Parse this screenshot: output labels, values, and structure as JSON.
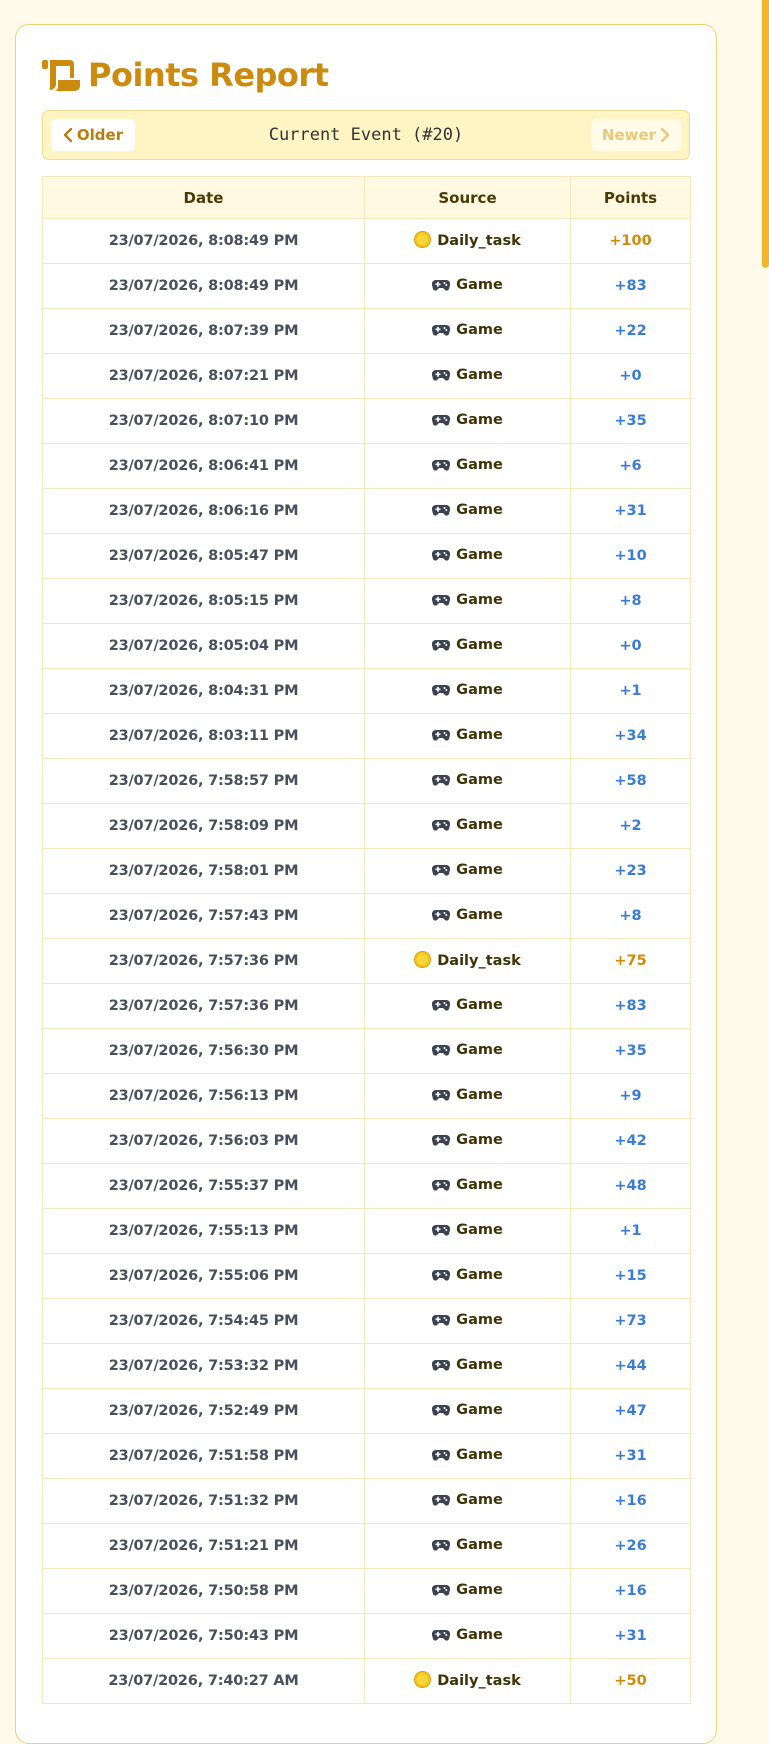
{
  "page": {
    "title": "Points Report",
    "title_icon": "scroll-icon",
    "accent_color": "#cc8a0f",
    "background_color": "#fffae9"
  },
  "nav": {
    "older_label": "Older",
    "newer_label": "Newer",
    "current_label": "Current Event (#20)",
    "newer_disabled": true
  },
  "table": {
    "headers": [
      "Date",
      "Source",
      "Points"
    ],
    "rows": [
      {
        "date": "23/07/2026, 8:08:49 PM",
        "source": "Daily_task",
        "icon": "coin-icon",
        "points": "+100"
      },
      {
        "date": "23/07/2026, 8:08:49 PM",
        "source": "Game",
        "icon": "gamepad-icon",
        "points": "+83"
      },
      {
        "date": "23/07/2026, 8:07:39 PM",
        "source": "Game",
        "icon": "gamepad-icon",
        "points": "+22"
      },
      {
        "date": "23/07/2026, 8:07:21 PM",
        "source": "Game",
        "icon": "gamepad-icon",
        "points": "+0"
      },
      {
        "date": "23/07/2026, 8:07:10 PM",
        "source": "Game",
        "icon": "gamepad-icon",
        "points": "+35"
      },
      {
        "date": "23/07/2026, 8:06:41 PM",
        "source": "Game",
        "icon": "gamepad-icon",
        "points": "+6"
      },
      {
        "date": "23/07/2026, 8:06:16 PM",
        "source": "Game",
        "icon": "gamepad-icon",
        "points": "+31"
      },
      {
        "date": "23/07/2026, 8:05:47 PM",
        "source": "Game",
        "icon": "gamepad-icon",
        "points": "+10"
      },
      {
        "date": "23/07/2026, 8:05:15 PM",
        "source": "Game",
        "icon": "gamepad-icon",
        "points": "+8"
      },
      {
        "date": "23/07/2026, 8:05:04 PM",
        "source": "Game",
        "icon": "gamepad-icon",
        "points": "+0"
      },
      {
        "date": "23/07/2026, 8:04:31 PM",
        "source": "Game",
        "icon": "gamepad-icon",
        "points": "+1"
      },
      {
        "date": "23/07/2026, 8:03:11 PM",
        "source": "Game",
        "icon": "gamepad-icon",
        "points": "+34"
      },
      {
        "date": "23/07/2026, 7:58:57 PM",
        "source": "Game",
        "icon": "gamepad-icon",
        "points": "+58"
      },
      {
        "date": "23/07/2026, 7:58:09 PM",
        "source": "Game",
        "icon": "gamepad-icon",
        "points": "+2"
      },
      {
        "date": "23/07/2026, 7:58:01 PM",
        "source": "Game",
        "icon": "gamepad-icon",
        "points": "+23"
      },
      {
        "date": "23/07/2026, 7:57:43 PM",
        "source": "Game",
        "icon": "gamepad-icon",
        "points": "+8"
      },
      {
        "date": "23/07/2026, 7:57:36 PM",
        "source": "Daily_task",
        "icon": "coin-icon",
        "points": "+75"
      },
      {
        "date": "23/07/2026, 7:57:36 PM",
        "source": "Game",
        "icon": "gamepad-icon",
        "points": "+83"
      },
      {
        "date": "23/07/2026, 7:56:30 PM",
        "source": "Game",
        "icon": "gamepad-icon",
        "points": "+35"
      },
      {
        "date": "23/07/2026, 7:56:13 PM",
        "source": "Game",
        "icon": "gamepad-icon",
        "points": "+9"
      },
      {
        "date": "23/07/2026, 7:56:03 PM",
        "source": "Game",
        "icon": "gamepad-icon",
        "points": "+42"
      },
      {
        "date": "23/07/2026, 7:55:37 PM",
        "source": "Game",
        "icon": "gamepad-icon",
        "points": "+48"
      },
      {
        "date": "23/07/2026, 7:55:13 PM",
        "source": "Game",
        "icon": "gamepad-icon",
        "points": "+1"
      },
      {
        "date": "23/07/2026, 7:55:06 PM",
        "source": "Game",
        "icon": "gamepad-icon",
        "points": "+15"
      },
      {
        "date": "23/07/2026, 7:54:45 PM",
        "source": "Game",
        "icon": "gamepad-icon",
        "points": "+73"
      },
      {
        "date": "23/07/2026, 7:53:32 PM",
        "source": "Game",
        "icon": "gamepad-icon",
        "points": "+44"
      },
      {
        "date": "23/07/2026, 7:52:49 PM",
        "source": "Game",
        "icon": "gamepad-icon",
        "points": "+47"
      },
      {
        "date": "23/07/2026, 7:51:58 PM",
        "source": "Game",
        "icon": "gamepad-icon",
        "points": "+31"
      },
      {
        "date": "23/07/2026, 7:51:32 PM",
        "source": "Game",
        "icon": "gamepad-icon",
        "points": "+16"
      },
      {
        "date": "23/07/2026, 7:51:21 PM",
        "source": "Game",
        "icon": "gamepad-icon",
        "points": "+26"
      },
      {
        "date": "23/07/2026, 7:50:58 PM",
        "source": "Game",
        "icon": "gamepad-icon",
        "points": "+16"
      },
      {
        "date": "23/07/2026, 7:50:43 PM",
        "source": "Game",
        "icon": "gamepad-icon",
        "points": "+31"
      },
      {
        "date": "23/07/2026, 7:40:27 AM",
        "source": "Daily_task",
        "icon": "coin-icon",
        "points": "+50"
      }
    ]
  },
  "colors": {
    "game_points": "#3a7bd5",
    "daily_task_points": "#d08a08",
    "scrollbar": "#f0b62e"
  }
}
